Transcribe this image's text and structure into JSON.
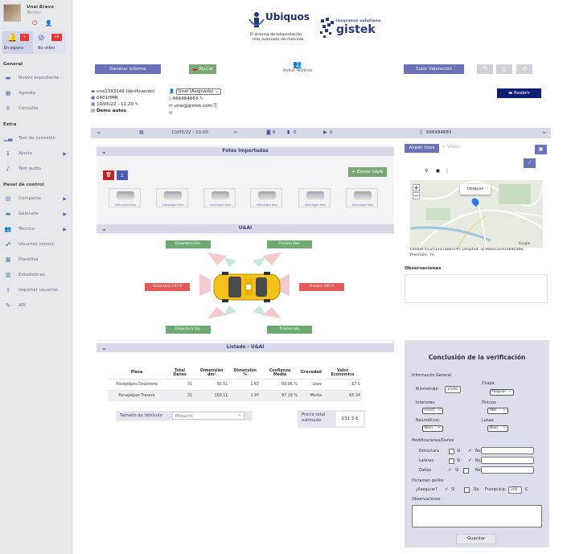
{
  "user": {
    "name": "Unai Bravo",
    "role": "Técnico",
    "counter_online": "2",
    "counter_video": "46",
    "label_online": "En espera",
    "label_video": "No vídeo"
  },
  "sidebar": {
    "general_title": "General",
    "general": [
      "Nuevo expediente",
      "Agenda",
      "Consulta"
    ],
    "extra_title": "Extra",
    "extra": [
      "Test de conexión",
      "Ayuda",
      "Test audio"
    ],
    "panel_title": "Panel de control",
    "panel": [
      "Compañía",
      "Gabinete",
      "Técnico",
      "Usuarios conect.",
      "Plantillas",
      "Estadísticas",
      "Importar usuarios",
      "API"
    ]
  },
  "brand": {
    "ubiquos": "Ubiquos",
    "ubiquos_tag1": "El sistema de teleperitación",
    "ubiquos_tag2": "más avanzado del mercado",
    "gistek_small": "insurance solutions",
    "gistek": "gistek"
  },
  "toolbar": {
    "generate_report": "Generar informe",
    "mycar": "MyCar",
    "techs": "Invitar Técnicos",
    "upload_valuation": "Subir Valoración"
  },
  "case": {
    "id": "una1393249 (Verificación)",
    "plate": "0401HMR",
    "datetime": "10/05/22 - 11:20",
    "demo": "Demo autos",
    "assignee": "Unai (Asignado)",
    "phone": "666484683",
    "email": "unai@gistek.com",
    "reassign": "Reabrir"
  },
  "infobar": {
    "datetime": "10/05/22 - 10:00",
    "photos": "6",
    "docs": "0",
    "videos": "0",
    "phone": "666484683"
  },
  "photos": {
    "title": "Fotos Importadas",
    "send_button": "Enviar U&AI",
    "link": "Descargar foto"
  },
  "uai": {
    "title": "U&AI",
    "front_right": "Delantera Der.",
    "rear_right": "Trasera Der.",
    "front": "Delantera 147 €",
    "rear": "Trasera 165 €",
    "front_left": "Delantera Izq.",
    "rear_left": "Trasera Izq."
  },
  "listing": {
    "title": "Listado - U&AI",
    "headers": [
      "Pieza",
      "Total Daños",
      "Dimensión dm²",
      "Dimensión %",
      "Confianza Media",
      "Gravedad",
      "Valor Económico"
    ],
    "rows": [
      [
        "Paragolpes Delantero",
        "31",
        "90.51",
        "1.67",
        "93.06 %",
        "Leve",
        "67 €"
      ],
      [
        "Paragolpes Trasero",
        "31",
        "100.11",
        "1.97",
        "97.19 %",
        "Media",
        "65.34"
      ]
    ],
    "size_label": "Tamaño de Vehículo",
    "size_value": "Pequeño",
    "price_label": "Precio total estimado",
    "price_value": "132.3 €"
  },
  "map": {
    "tab_photos": "Añadir fotos",
    "tab_video": "Vídeo",
    "marker": "Ubiquos",
    "coords": "Latitud:43.2513173083797 Longitud: -2.9606152915690366",
    "precision": "Precisión: -m",
    "google": "Google",
    "observations": "Observaciones"
  },
  "conclusion": {
    "title": "Conclusión de la verificación",
    "general_info": "Información General:",
    "km_label": "Kilometraje:",
    "km_value": "15/00",
    "chapa_label": "Chapa:",
    "chapa_value": "Regular",
    "interior_label": "Interiores:",
    "interior_value": "Excel",
    "pintura_label": "Pintura:",
    "pintura_value": "Mal",
    "neumaticos_label": "Neumáticos:",
    "neumaticos_value": "Bien",
    "lunas_label": "Lunas:",
    "lunas_value": "Bien",
    "mods_label": "Modificaciones/Daños:",
    "mod_rows": [
      "Estructura",
      "Lateras",
      "Daños"
    ],
    "yes": "Sí",
    "no": "No",
    "dictamen": "Dictamen perito:",
    "asegurar": "¿Asegurar?",
    "franquicia": "Franquicia:",
    "franquicia_value": "200",
    "currency": "€",
    "obs": "Observaciones:",
    "save": "Guardar"
  }
}
